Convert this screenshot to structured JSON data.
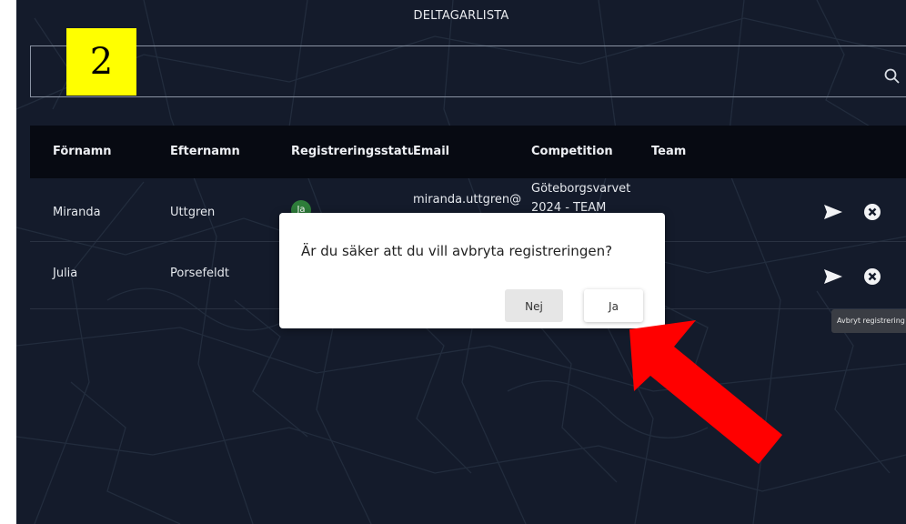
{
  "page": {
    "title": "DELTAGARLISTA"
  },
  "search": {
    "placeholder": "",
    "value": ""
  },
  "table": {
    "columns": [
      "Förnamn",
      "Efternamn",
      "Registreringsstatus",
      "Email",
      "Competition",
      "Team"
    ],
    "rows": [
      {
        "first_name": "Miranda",
        "last_name": "Uttgren",
        "status": "Ja",
        "email": "miranda.uttgren@",
        "competition_line1": "Göteborgsvarvet",
        "competition_line2": "2024 - TEAM",
        "team": ""
      },
      {
        "first_name": "Julia",
        "last_name": "Porsefeldt",
        "status": "",
        "email": "",
        "competition_line1": "",
        "competition_line2": "",
        "team": ""
      }
    ]
  },
  "tooltip": {
    "text": "Avbryt registrering"
  },
  "dialog": {
    "message": "Är du säker att du vill avbryta registreringen?",
    "no_label": "Nej",
    "yes_label": "Ja"
  },
  "annotation": {
    "step_number": "2"
  },
  "colors": {
    "background": "#141b2b",
    "header": "#070a12",
    "badge_green": "#2e7d3a",
    "annotation_yellow": "#ffff00",
    "arrow_red": "#ff0000"
  },
  "icons": {
    "search": "search-icon",
    "send": "send-icon",
    "cancel": "cancel-icon",
    "arrow": "arrow-icon"
  }
}
